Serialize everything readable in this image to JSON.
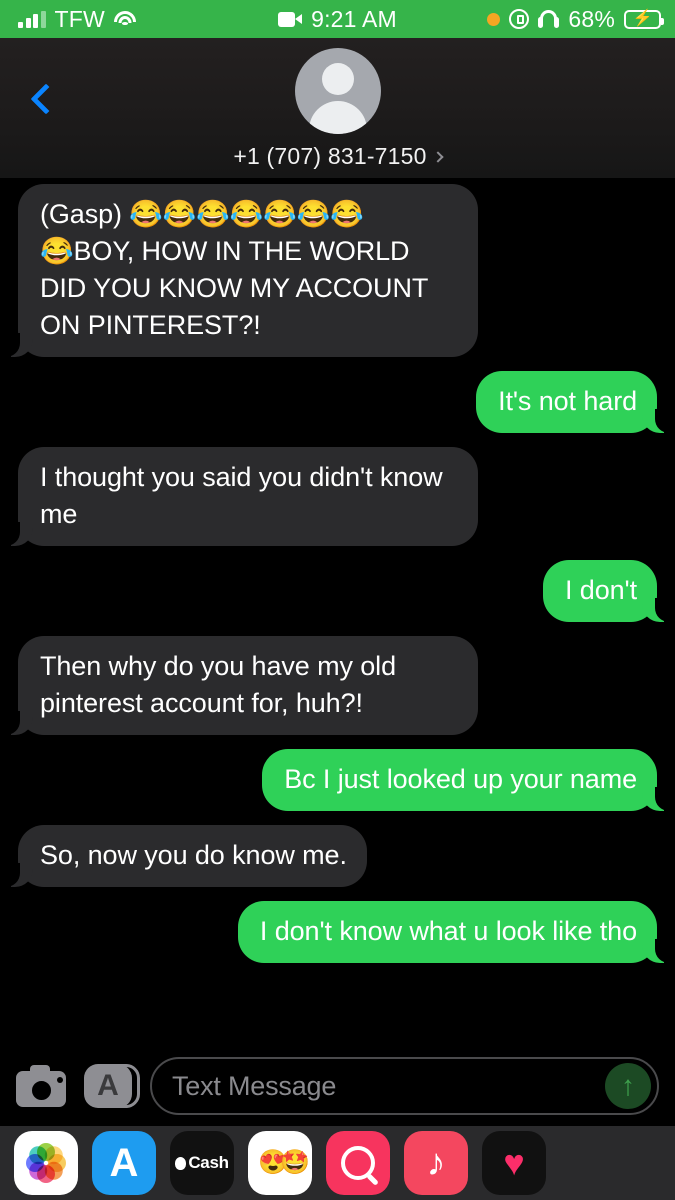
{
  "status_bar": {
    "carrier": "TFW",
    "signal_icon": "signal-bars-icon",
    "wifi_icon": "wifi-icon",
    "recording_icon": "video-record-icon",
    "time": "9:21 AM",
    "mic_indicator_icon": "orange-dot-icon",
    "rotation_lock_icon": "rotation-lock-icon",
    "headphones_icon": "headphones-icon",
    "battery_percent": "68%",
    "battery_icon": "battery-charging-icon",
    "bar_color": "#36b44a"
  },
  "nav": {
    "back_icon": "chevron-left-icon",
    "avatar_icon": "contact-avatar-placeholder-icon",
    "contact_name": "+1 (707) 831-7150",
    "detail_chevron_icon": "chevron-right-icon",
    "back_tint": "#0a84ff"
  },
  "conversation": {
    "incoming_bubble_color": "#2b2b2d",
    "outgoing_bubble_color": "#2fd158",
    "messages": [
      {
        "direction": "in",
        "text": "(Gasp) 😂😂😂😂😂😂😂\n😂BOY, HOW IN THE WORLD DID YOU KNOW MY ACCOUNT ON PINTEREST?!"
      },
      {
        "direction": "out",
        "text": "It's not hard"
      },
      {
        "direction": "in",
        "text": "I thought you said you didn't know me"
      },
      {
        "direction": "out",
        "text": "I don't"
      },
      {
        "direction": "in",
        "text": "Then why do you have my old pinterest account for, huh?!"
      },
      {
        "direction": "out",
        "text": "Bc I just looked up your name"
      },
      {
        "direction": "in",
        "text": "So, now you do know me."
      },
      {
        "direction": "out",
        "text": "I don't know what u look like tho"
      }
    ]
  },
  "input_bar": {
    "camera_icon": "camera-icon",
    "appstore_icon": "app-store-icon",
    "appstore_glyph": "A",
    "placeholder": "Text Message",
    "send_icon": "send-arrow-up-icon",
    "send_glyph": "↑"
  },
  "app_dock": {
    "apps": [
      {
        "name": "photos",
        "icon": "photos-app-icon",
        "label": ""
      },
      {
        "name": "app-store",
        "icon": "app-store-app-icon",
        "label": "A"
      },
      {
        "name": "apple-cash",
        "icon": "apple-cash-app-icon",
        "label": "Cash"
      },
      {
        "name": "memoji",
        "icon": "memoji-stickers-icon",
        "label": ""
      },
      {
        "name": "images",
        "icon": "images-search-icon",
        "label": ""
      },
      {
        "name": "music",
        "icon": "apple-music-icon",
        "label": "♪"
      },
      {
        "name": "digital-touch",
        "icon": "digital-touch-heart-icon",
        "label": ""
      }
    ]
  }
}
